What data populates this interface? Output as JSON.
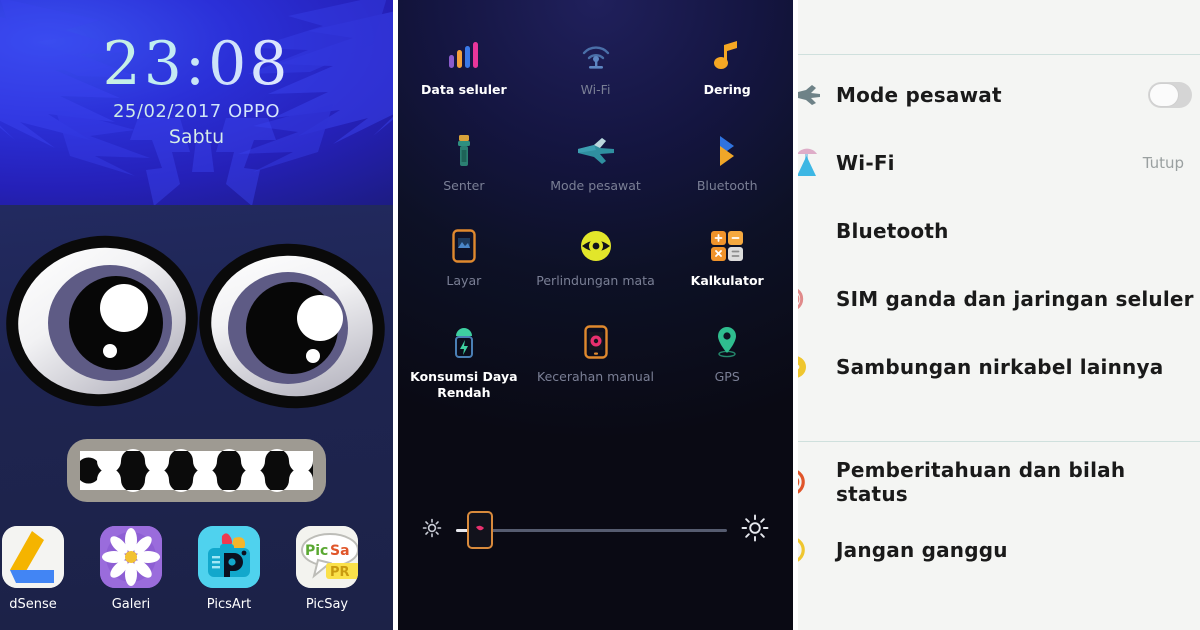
{
  "lockscreen": {
    "time": "23:08",
    "date": "25/02/2017 OPPO",
    "day": "Sabtu",
    "dock": [
      {
        "label": "dSense",
        "icon": "adsense-icon"
      },
      {
        "label": "Galeri",
        "icon": "gallery-icon"
      },
      {
        "label": "PicsArt",
        "icon": "picsart-icon"
      },
      {
        "label": "PicSay ",
        "icon": "picsay-icon"
      }
    ]
  },
  "quick_settings": {
    "tiles": [
      {
        "label": "Data seluler",
        "icon": "signal-bars-icon",
        "active": true
      },
      {
        "label": "Wi-Fi",
        "icon": "wifi-icon",
        "active": false
      },
      {
        "label": "Dering",
        "icon": "music-note-icon",
        "active": true
      },
      {
        "label": "Senter",
        "icon": "flashlight-icon",
        "active": false
      },
      {
        "label": "Mode pesawat",
        "icon": "airplane-icon",
        "active": false
      },
      {
        "label": "Bluetooth",
        "icon": "bluetooth-icon",
        "active": false
      },
      {
        "label": "Layar",
        "icon": "screenshot-icon",
        "active": false
      },
      {
        "label": "Perlindungan mata",
        "icon": "eye-care-icon",
        "active": false
      },
      {
        "label": "Kalkulator",
        "icon": "calculator-icon",
        "active": true
      },
      {
        "label": "Konsumsi Daya Rendah",
        "icon": "power-saving-icon",
        "active": true
      },
      {
        "label": "Kecerahan manual",
        "icon": "manual-brightness-icon",
        "active": false
      },
      {
        "label": "GPS",
        "icon": "location-pin-icon",
        "active": false
      }
    ],
    "brightness": {
      "low_icon": "brightness-low-icon",
      "high_icon": "brightness-high-icon",
      "value_percent": 9
    }
  },
  "settings": {
    "group1": [
      {
        "label": "Mode pesawat",
        "icon": "airplane-icon",
        "control": "toggle",
        "value": ""
      },
      {
        "label": "Wi-Fi",
        "icon": "wifi-icon",
        "control": "value",
        "value": "Tutup"
      },
      {
        "label": "Bluetooth",
        "icon": "bluetooth-icon",
        "control": "none",
        "value": ""
      },
      {
        "label": "SIM ganda dan jaringan seluler",
        "icon": "sim-card-icon",
        "control": "none",
        "value": ""
      },
      {
        "label": "Sambungan nirkabel lainnya",
        "icon": "wireless-icon",
        "control": "none",
        "value": ""
      }
    ],
    "group2": [
      {
        "label": "Pemberitahuan dan bilah status",
        "icon": "notification-icon",
        "control": "none",
        "value": ""
      },
      {
        "label": "Jangan ganggu",
        "icon": "do-not-disturb-icon",
        "control": "none",
        "value": ""
      }
    ]
  },
  "colors": {
    "lock_bg": "#2b30d8",
    "qs_bg": "#0d1126",
    "settings_bg": "#f4f5f3",
    "accent_orange": "#f08a28",
    "accent_yellow": "#e2e62a"
  }
}
